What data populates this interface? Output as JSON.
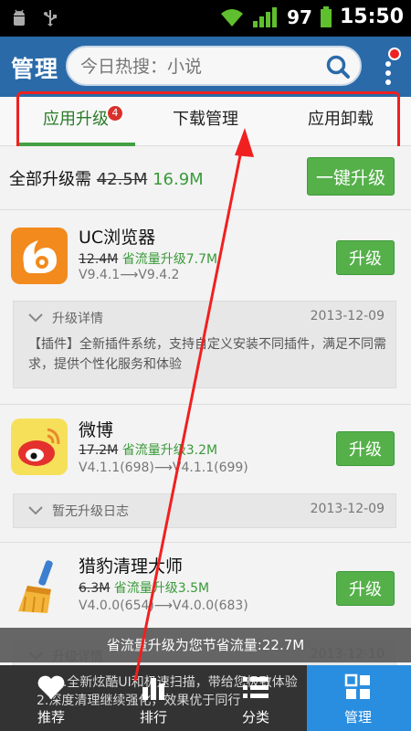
{
  "status_bar": {
    "battery": "97",
    "time": "15:50"
  },
  "app_bar": {
    "title": "管理",
    "search_placeholder": "今日热搜：小说"
  },
  "tabs": [
    {
      "label": "应用升级",
      "badge": "4",
      "active": true
    },
    {
      "label": "下载管理",
      "active": false
    },
    {
      "label": "应用卸载",
      "active": false
    }
  ],
  "summary": {
    "prefix": "全部升级需",
    "old_size": "42.5M",
    "new_size": "16.9M",
    "button": "一键升级"
  },
  "apps": [
    {
      "name": "UC浏览器",
      "old_size": "12.4M",
      "save_text": "省流量升级7.7M",
      "version": "V9.4.1⟶V9.4.2",
      "button": "升级",
      "detail_title": "升级详情",
      "detail_date": "2013-12-09",
      "detail_body": "【插件】全新插件系统，支持自定义安装不同插件，满足不同需求，提供个性化服务和体验"
    },
    {
      "name": "微博",
      "old_size": "17.2M",
      "save_text": "省流量升级3.2M",
      "version": "V4.1.1(698)⟶V4.1.1(699)",
      "button": "升级",
      "detail_title": "暂无升级日志",
      "detail_date": "2013-12-09"
    },
    {
      "name": "猎豹清理大师",
      "old_size": "6.3M",
      "save_text": "省流量升级3.5M",
      "version": "V4.0.0(654)⟶V4.0.0(683)",
      "button": "升级",
      "detail_title": "升级详情",
      "detail_date": "2013-12-10",
      "detail_body_1": "1.全新炫酷UI和极速扫描，带给您极致体验",
      "detail_body_2": "2.深度清理继续强化，效果优于同行"
    }
  ],
  "toast": "省流量升级为您节省流量:22.7M",
  "bottom_nav": [
    {
      "label": "推荐",
      "icon": "heart-icon"
    },
    {
      "label": "排行",
      "icon": "bar-chart-icon"
    },
    {
      "label": "分类",
      "icon": "list-icon"
    },
    {
      "label": "管理",
      "icon": "grid-icon",
      "active": true
    }
  ],
  "colors": {
    "app_bar": "#2a6aa9",
    "accent_green": "#55b04a",
    "nav_active": "#2a8ee0",
    "highlight_red": "#f02020"
  }
}
